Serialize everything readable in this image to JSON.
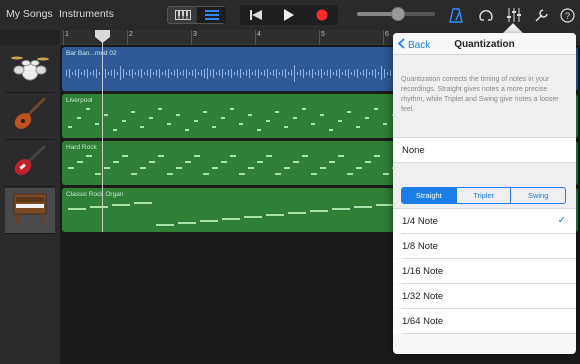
{
  "toolbar": {
    "my_songs": "My Songs",
    "instruments": "Instruments",
    "volume_level": 0.52,
    "accent": "#2f8cff",
    "record_color": "#ff2b2b"
  },
  "ruler": {
    "marks": [
      "1",
      "2",
      "3",
      "4",
      "5",
      "6"
    ]
  },
  "tracks": [
    {
      "icon": "drum-kit-icon",
      "region": "Bar Ban...med 02",
      "color": "#2e5a98"
    },
    {
      "icon": "bass-guitar-icon",
      "region": "Liverpool",
      "color": "#2f7f34"
    },
    {
      "icon": "electric-guitar-icon",
      "region": "Hard Rock",
      "color": "#2f7f34"
    },
    {
      "icon": "organ-icon",
      "region": "Classic Rock Organ",
      "color": "#2f7f34"
    }
  ],
  "popover": {
    "back_label": "Back",
    "title": "Quantization",
    "description": "Quantization corrects the timing of notes in your recordings. Straight gives notes a more precise rhythm, while Triplet and Swing give notes a looser feel.",
    "none_label": "None",
    "tabs": [
      "Straight",
      "Triplet",
      "Swing"
    ],
    "selected_tab": "Straight",
    "options": [
      "1/4 Note",
      "1/8 Note",
      "1/16 Note",
      "1/32 Note",
      "1/64 Note"
    ],
    "selected_option": "1/4 Note",
    "check_glyph": "✓"
  }
}
